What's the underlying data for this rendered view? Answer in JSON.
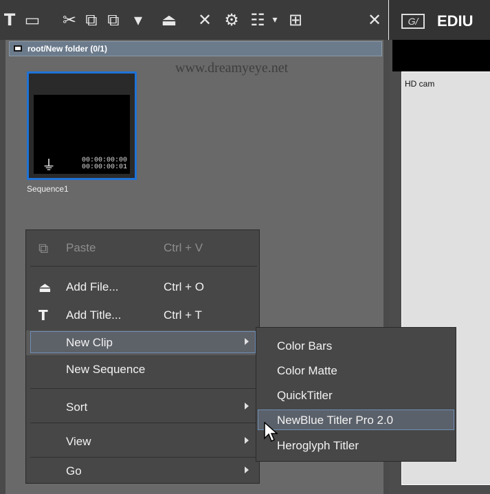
{
  "toolbar": {
    "icons": [
      "T",
      "▭",
      "✂",
      "⧉",
      "⧉",
      "▾",
      "⏏",
      "✕",
      "⚙",
      "☷",
      "▾",
      "⊞",
      "✕"
    ]
  },
  "bin": {
    "path": "root/New folder (0/1)",
    "watermark": "www.dreamyeye.net",
    "clip": {
      "name": "Sequence1",
      "tc_in": "00:00:00:00",
      "tc_out": "00:00:00:01"
    }
  },
  "preview": {
    "app_title": "EDIU",
    "logo": "G/",
    "label": "HD cam"
  },
  "context_menu": {
    "paste": {
      "label": "Paste",
      "accel": "P",
      "shortcut": "Ctrl + V"
    },
    "add_file": {
      "label": "Add File...",
      "shortcut": "Ctrl + O"
    },
    "add_title": {
      "label": "Add Title...",
      "shortcut": "Ctrl + T"
    },
    "new_clip": {
      "label": "New Clip"
    },
    "new_sequence": {
      "label": "New Sequence"
    },
    "sort": {
      "label": "Sort"
    },
    "view": {
      "label": "View"
    },
    "go": {
      "label": "Go"
    }
  },
  "submenu": {
    "items": [
      "Color Bars",
      "Color Matte",
      "QuickTitler",
      "NewBlue Titler Pro 2.0",
      "Heroglyph Titler"
    ]
  },
  "colors": {
    "selection_border": "#1f73d8",
    "menu_bg": "#474747",
    "highlight_border": "#6f8fb8"
  }
}
